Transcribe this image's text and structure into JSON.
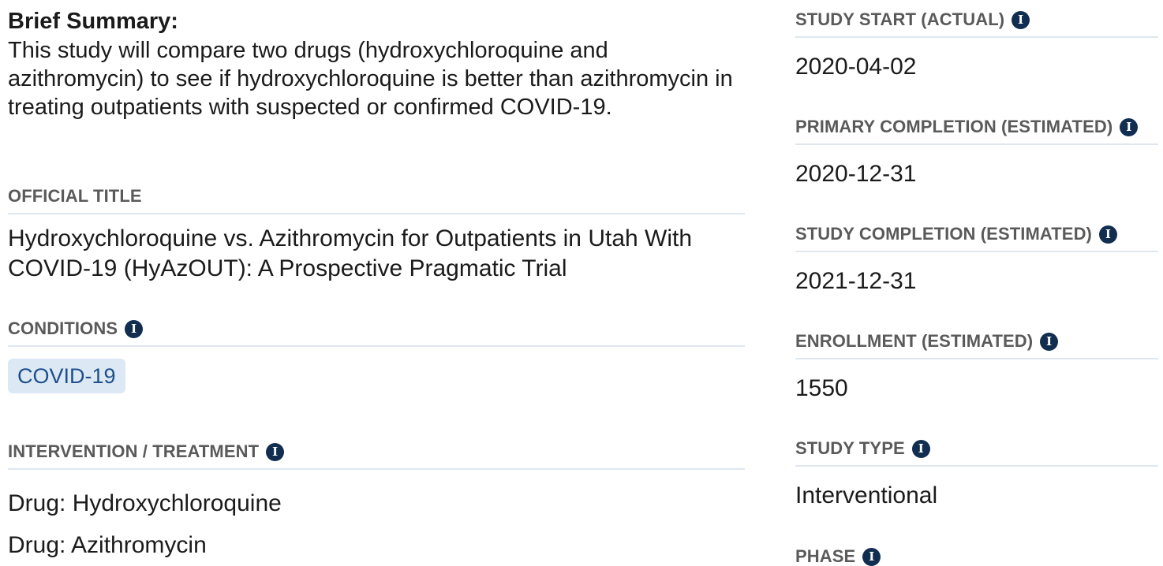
{
  "summary": {
    "heading": "Brief Summary:",
    "text": "This study will compare two drugs (hydroxychloroquine and azithromycin) to see if hydroxychloroquine is better than azithromycin in treating outpatients with suspected or confirmed COVID-19."
  },
  "official_title": {
    "label": "OFFICIAL TITLE",
    "value": "Hydroxychloroquine vs. Azithromycin for Outpatients in Utah With COVID-19 (HyAzOUT): A Prospective Pragmatic Trial"
  },
  "conditions": {
    "label": "CONDITIONS",
    "items": [
      "COVID-19"
    ]
  },
  "intervention": {
    "label": "INTERVENTION / TREATMENT",
    "items": [
      "Drug: Hydroxychloroquine",
      "Drug: Azithromycin"
    ]
  },
  "study_start": {
    "label": "STUDY START (ACTUAL)",
    "value": "2020-04-02"
  },
  "primary_completion": {
    "label": "PRIMARY COMPLETION (ESTIMATED)",
    "value": "2020-12-31"
  },
  "study_completion": {
    "label": "STUDY COMPLETION (ESTIMATED)",
    "value": "2021-12-31"
  },
  "enrollment": {
    "label": "ENROLLMENT (ESTIMATED)",
    "value": "1550"
  },
  "study_type": {
    "label": "STUDY TYPE",
    "value": "Interventional"
  },
  "phase": {
    "label": "PHASE"
  },
  "icons": {
    "info": "info-icon",
    "info_glyph": "i"
  },
  "colors": {
    "label_text": "#5a5a5a",
    "divider": "#dfe7ef",
    "info_icon_bg": "#112e51",
    "tag_bg": "#dce9f5",
    "tag_text": "#1d4f8c"
  }
}
